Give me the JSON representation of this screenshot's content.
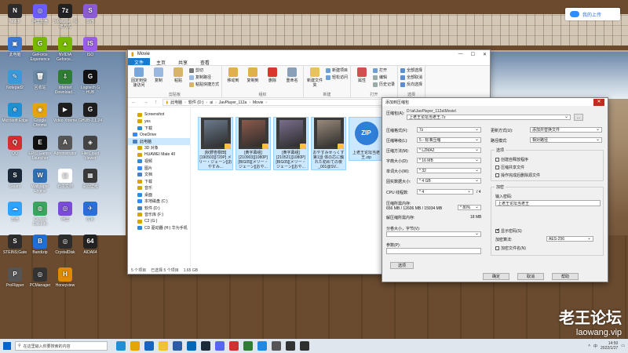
{
  "desktop": {
    "icons": [
      {
        "label": "Notch",
        "color": "#2d2d2d",
        "glyph": "N"
      },
      {
        "label": "阿里云盘",
        "color": "#6a5cff",
        "glyph": "◎"
      },
      {
        "label": "7zFM.exe - 快捷方式",
        "color": "#222222",
        "glyph": "7z"
      },
      {
        "label": "SVB",
        "color": "#8b5bd6",
        "glyph": "S"
      },
      {
        "label": "此电脑",
        "color": "#3a7bd5",
        "glyph": "▣"
      },
      {
        "label": "GeForce Experience",
        "color": "#76b900",
        "glyph": "G"
      },
      {
        "label": "NVIDIA Geforce...",
        "color": "#76b900",
        "glyph": "▲"
      },
      {
        "label": "ISO",
        "color": "#9a5de8",
        "glyph": "IS"
      },
      {
        "label": "Notepad2",
        "color": "#3a9ad9",
        "glyph": "✎"
      },
      {
        "label": "回收站",
        "color": "#6c8aa6",
        "glyph": "🗑"
      },
      {
        "label": "Internet Download...",
        "color": "#2e7d32",
        "glyph": "⇩"
      },
      {
        "label": "Logitech G HUB",
        "color": "#111111",
        "glyph": "G"
      },
      {
        "label": "Microsoft Edge",
        "color": "#1f8fd6",
        "glyph": "e"
      },
      {
        "label": "Google Chrome",
        "color": "#e5a50a",
        "glyph": "◉"
      },
      {
        "label": "Video Xtreme",
        "color": "#1e1e1e",
        "glyph": "▶"
      },
      {
        "label": "GHUB-2.1.24",
        "color": "#1e1e1e",
        "glyph": "G"
      },
      {
        "label": "QQ",
        "color": "#d32f2f",
        "glyph": "Q"
      },
      {
        "label": "EPIC Games Launcher",
        "color": "#111111",
        "glyph": "E"
      },
      {
        "label": "Administrator",
        "color": "#555555",
        "glyph": "A"
      },
      {
        "label": "File Cloud Viewer",
        "color": "#444444",
        "glyph": "◈"
      },
      {
        "label": "Steam",
        "color": "#1b2838",
        "glyph": "S"
      },
      {
        "label": "Wallpaper Engine",
        "color": "#2f6fb3",
        "glyph": "W"
      },
      {
        "label": "石墨文档",
        "color": "#ffffff",
        "glyph": "▤"
      },
      {
        "label": "桌面壁纸",
        "color": "#3a3a3a",
        "glyph": "▦"
      },
      {
        "label": "云盘",
        "color": "#2fa4ff",
        "glyph": "☁"
      },
      {
        "label": "Crystal DiskInfo",
        "color": "#3aa55e",
        "glyph": "◍"
      },
      {
        "label": "阿里",
        "color": "#7a4bd6",
        "glyph": "◎"
      },
      {
        "label": "优化",
        "color": "#2a6fd6",
        "glyph": "✈"
      },
      {
        "label": "STEINS;Gate",
        "color": "#2d2d2d",
        "glyph": "S"
      },
      {
        "label": "Bandizip",
        "color": "#1f6fd6",
        "glyph": "B"
      },
      {
        "label": "CrystalDisk",
        "color": "#2d2d2d",
        "glyph": "◎"
      },
      {
        "label": "AIDA64",
        "color": "#222222",
        "glyph": "64"
      },
      {
        "label": "ProFlipper",
        "color": "#555555",
        "glyph": "P"
      },
      {
        "label": "PCManager",
        "color": "#333333",
        "glyph": "◎"
      },
      {
        "label": "Honeyview",
        "color": "#e08a00",
        "glyph": "H"
      }
    ],
    "cloud_button": "我的上传"
  },
  "explorer": {
    "title": "Movie",
    "ribbon_tabs": [
      "文件",
      "主页",
      "共享",
      "查看"
    ],
    "ribbon": {
      "clipboard": {
        "label": "剪贴板",
        "pin": "固定到快速访问",
        "copy": "复制",
        "paste": "粘贴",
        "cut": "剪切",
        "copy_path": "复制路径",
        "paste_shortcut": "粘贴快捷方式"
      },
      "organize": {
        "label": "组织",
        "move_to": "移动到",
        "copy_to": "复制到",
        "delete": "删除",
        "rename": "重命名"
      },
      "new": {
        "label": "新建",
        "new_folder": "新建文件夹",
        "new_item": "新建项目",
        "easy_access": "轻松访问"
      },
      "open": {
        "label": "打开",
        "properties": "属性",
        "open": "打开",
        "edit": "编辑",
        "history": "历史记录"
      },
      "select": {
        "label": "选择",
        "select_all": "全部选择",
        "select_none": "全部取消",
        "invert": "反向选择"
      }
    },
    "path": [
      "此电脑",
      "软件 (D:)",
      "ai",
      "JavPlayer_112a",
      "Movie"
    ],
    "nav": [
      {
        "label": "Screenshot",
        "indent": true
      },
      {
        "label": "yes",
        "indent": true
      },
      {
        "label": "下载",
        "indent": true
      },
      {
        "label": "OneDrive",
        "indent": false
      },
      {
        "label": "此电脑",
        "indent": false,
        "selected": true
      },
      {
        "label": "3D 对象",
        "indent": true
      },
      {
        "label": "HUAWEI Mate 40",
        "indent": true
      },
      {
        "label": "视频",
        "indent": true
      },
      {
        "label": "图片",
        "indent": true
      },
      {
        "label": "文档",
        "indent": true
      },
      {
        "label": "下载",
        "indent": true
      },
      {
        "label": "音乐",
        "indent": true
      },
      {
        "label": "桌面",
        "indent": true
      },
      {
        "label": "本地磁盘 (C:)",
        "indent": true
      },
      {
        "label": "软件 (D:)",
        "indent": true
      },
      {
        "label": "音乐库 (F:)",
        "indent": true
      },
      {
        "label": "C2 (G:)",
        "indent": true
      },
      {
        "label": "CD 驱动器 (H:) 华为手机",
        "indent": true
      }
    ],
    "files": [
      {
        "name": "[秋野杏樹田] [190503][720P] メリー・ジェーン][おやすみ...",
        "type": "video",
        "tint": "#6b7a8c"
      },
      {
        "name": "[黄字幕组] [210903][1080P] [BIG05][メリー・ジェーン][おや...",
        "type": "video",
        "tint": "#8b5a4a"
      },
      {
        "name": "[黄字幕组] [210521][1080P] [BIG05][メリー・ジェーン][おや...",
        "type": "video",
        "tint": "#7a6e8c"
      },
      {
        "name": "おやすみせっくす 第1話 体の芯に触れた初めての夜_001@SV...",
        "type": "video",
        "tint": "#9a8a7a"
      },
      {
        "name": "上老王论坛当老王.zip",
        "type": "zip",
        "tint": "#2f7ed8"
      }
    ],
    "status": {
      "count": "5 个项目",
      "selected": "已选择 5 个项目",
      "size": "1.65 GB"
    }
  },
  "dialog": {
    "title": "添加到压缩包",
    "archive_label": "压缩包(A):",
    "archive_dir": "D:\\ai\\JavPlayer_112a\\Movie\\",
    "archive_name": "上老王论坛当老王.7z",
    "browse": "...",
    "format_label": "压缩格式(F):",
    "format": "7z",
    "level_label": "压缩等级(L):",
    "level": "5 - 标准压缩",
    "method_label": "压缩方法(M):",
    "method": "* LZMA2",
    "dict_label": "字典大小(D):",
    "dict": "* 16 MB",
    "word_label": "单词大小(W):",
    "word": "* 32",
    "solid_label": "固实数据大小:",
    "solid": "* 4 GB",
    "cpu_label": "CPU 线程数:",
    "cpu": "* 4",
    "cpu_max": "/ 4",
    "mem_label": "压缩所需内存:",
    "mem_value": "656 MB / 12606 MB / 15934 MB",
    "mem_pct": "* 80%",
    "decomp_label": "解压缩所需内存:",
    "decomp_value": "18 MB",
    "split_label": "分卷大小，字节(V):",
    "params_label": "参数(P):",
    "options_button": "选项",
    "update_label": "更新方式(U):",
    "update": "添加并替换文件",
    "pathmode_label": "路径模式:",
    "pathmode": "相对路径",
    "options_group": "选项",
    "opt_sfx": "创建自释放程序",
    "opt_shared": "压缩共享文件",
    "opt_delete": "操作完成后删除源文件",
    "enc_group": "加密",
    "pwd_label": "输入密码:",
    "pwd_value": "上老王论坛当老王",
    "show_pwd": "显示密码(S)",
    "enc_method_label": "加密算法:",
    "enc_method": "AES-256",
    "enc_names": "加密文件名(N)",
    "ok": "确定",
    "cancel": "取消",
    "help": "帮助"
  },
  "taskbar": {
    "search_placeholder": "在这里输入你要搜索的内容",
    "apps": [
      "#1f8fd6",
      "#e5a50a",
      "#1565c0",
      "#f2c230",
      "#2a5ca8",
      "#0067b8",
      "#1b2838",
      "#5865f2",
      "#d32f2f",
      "#2e7d32",
      "#1e88e5",
      "#555555",
      "#333333",
      "#2f2f2f"
    ],
    "tray_lang": "中",
    "time": "14:50",
    "date": "2022/1/27"
  },
  "watermark": {
    "cn": "老王论坛",
    "url": "laowang.vip"
  }
}
